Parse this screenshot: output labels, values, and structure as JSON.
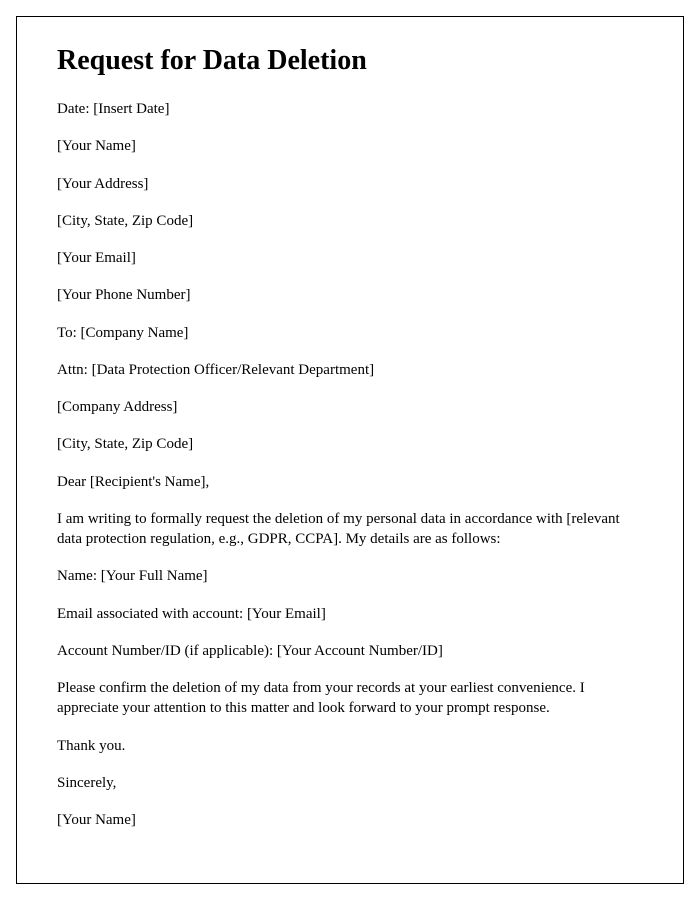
{
  "title": "Request for Data Deletion",
  "lines": {
    "date": "Date: [Insert Date]",
    "your_name": "[Your Name]",
    "your_address": "[Your Address]",
    "your_city": "[City, State, Zip Code]",
    "your_email": "[Your Email]",
    "your_phone": "[Your Phone Number]",
    "to_company": "To: [Company Name]",
    "attn": "Attn: [Data Protection Officer/Relevant Department]",
    "company_address": "[Company Address]",
    "company_city": "[City, State, Zip Code]",
    "salutation": "Dear [Recipient's Name],",
    "body1": "I am writing to formally request the deletion of my personal data in accordance with [relevant data protection regulation, e.g., GDPR, CCPA]. My details are as follows:",
    "detail_name": "Name: [Your Full Name]",
    "detail_email": "Email associated with account: [Your Email]",
    "detail_account": "Account Number/ID (if applicable): [Your Account Number/ID]",
    "body2": "Please confirm the deletion of my data from your records at your earliest convenience. I appreciate your attention to this matter and look forward to your prompt response.",
    "thanks": "Thank you.",
    "closing": "Sincerely,",
    "signature": "[Your Name]"
  }
}
